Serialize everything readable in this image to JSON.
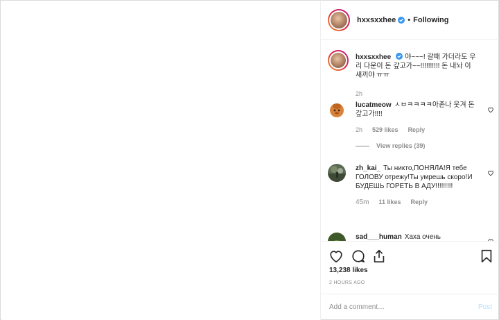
{
  "header": {
    "username": "hxxsxxhee",
    "separator": "•",
    "follow_status": "Following"
  },
  "caption": {
    "username": "hxxsxxhee",
    "text": "야~~~! 갈때 가더라도 우리 다운이 돈 갚고가~~!!!!!!!!!! 돈 내놔 이새끼야 ㅠㅠ",
    "time": "2h"
  },
  "comments": [
    {
      "username": "lucatmeow",
      "text": "ㅅㅂㅋㅋㅋㅋ아존나 웃겨 돈갚고가!!!!",
      "time": "2h",
      "likes": "529 likes",
      "reply": "Reply",
      "view_replies": "View replies (39)"
    },
    {
      "username": "zh_kai_",
      "text": "Ты никто,ПОНЯЛА!Я тебе ГОЛОВУ отрежу!Ты умрешь скоро!И БУДЕШЬ ГОРЕТЬ В АДУ!!!!!!!!!",
      "time": "45m",
      "likes": "11 likes",
      "reply": "Reply"
    },
    {
      "username": "sad___human",
      "text": "Хаха очень"
    }
  ],
  "actions": {
    "likes_count": "13,238 likes",
    "posted_time": "2 HOURS AGO"
  },
  "add_comment": {
    "placeholder": "Add a comment…",
    "post_label": "Post"
  },
  "colors": {
    "accent_blue": "#3897f0",
    "muted": "#8e8e8e",
    "post_disabled": "#b2dffc"
  }
}
